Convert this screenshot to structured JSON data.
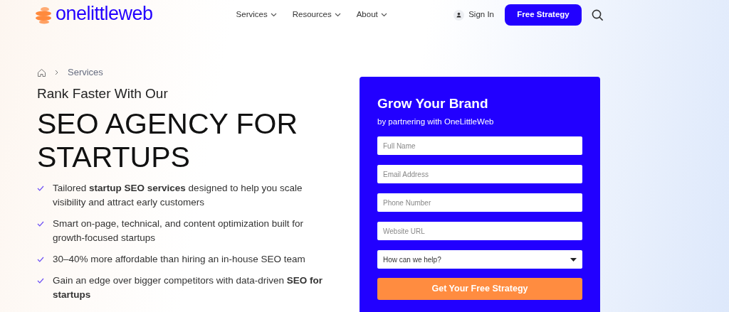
{
  "header": {
    "logo": "onelittleweb",
    "nav": [
      {
        "label": "Services"
      },
      {
        "label": "Resources"
      },
      {
        "label": "About"
      }
    ],
    "sign_in": "Sign In",
    "cta": "Free Strategy"
  },
  "breadcrumb": [
    "Services"
  ],
  "hero": {
    "kicker": "Rank Faster With Our",
    "title_lines": [
      "SEO AGENCY FOR",
      "STARTUPS"
    ],
    "bullets": [
      "Tailored **startup SEO services** designed to help you scale visibility and attract early customers",
      "Smart on-page, technical, and content optimization built for growth-focused startups",
      "30–40% more affordable than hiring an in-house SEO team",
      "Gain an edge over bigger competitors with data-driven **SEO for startups**"
    ]
  },
  "form": {
    "title": "Grow Your Brand",
    "subtitle": "by partnering with OneLittleWeb",
    "fields": [
      {
        "kind": "text",
        "placeholder": "Full Name"
      },
      {
        "kind": "text",
        "placeholder": "Email Address"
      },
      {
        "kind": "text",
        "placeholder": "Phone Number"
      },
      {
        "kind": "text",
        "placeholder": "Website URL"
      },
      {
        "kind": "select",
        "value": "How can we help?"
      }
    ],
    "submit": "Get Your Free Strategy"
  }
}
